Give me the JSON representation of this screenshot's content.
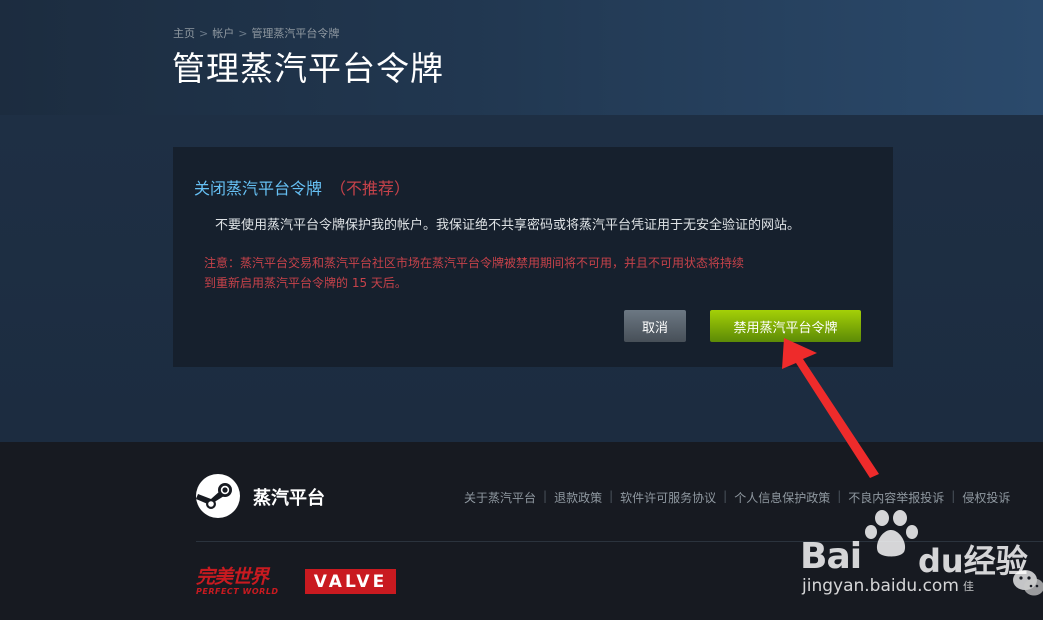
{
  "breadcrumb": {
    "home": "主页",
    "account": "帐户",
    "current": "管理蒸汽平台令牌",
    "separator": ">"
  },
  "page": {
    "title": "管理蒸汽平台令牌"
  },
  "dialog": {
    "title": "关闭蒸汽平台令牌",
    "not_recommended": "（不推荐）",
    "description": "不要使用蒸汽平台令牌保护我的帐户。我保证绝不共享密码或将蒸汽平台凭证用于无安全验证的网站。",
    "warning_line1": "注意：蒸汽平台交易和蒸汽平台社区市场在蒸汽平台令牌被禁用期间将不可用，并且不可用状态将持续",
    "warning_line2": "到重新启用蒸汽平台令牌的 15 天后。",
    "cancel_label": "取消",
    "disable_label": "禁用蒸汽平台令牌"
  },
  "footer": {
    "brand": "蒸汽平台",
    "links": [
      "关于蒸汽平台",
      "退款政策",
      "软件许可服务协议",
      "个人信息保护政策",
      "不良内容举报投诉",
      "侵权投诉"
    ],
    "partner_pw_main": "完美世界",
    "partner_pw_sub": "PERFECT WORLD",
    "partner_valve": "VALVE"
  },
  "watermark": {
    "brand": "Bai",
    "brand_cn": "du经验",
    "url": "jingyan.baidu.com",
    "small": "佳"
  },
  "colors": {
    "accent_blue": "#66c0f4",
    "warning_red": "#c6424a",
    "button_green": "#a4d007",
    "annotation_arrow": "#ee2b2b"
  },
  "icons": {
    "steam": "steam-logo-icon",
    "annotation": "red-arrow-icon",
    "paw": "baidu-paw-icon",
    "wechat": "wechat-icon"
  }
}
